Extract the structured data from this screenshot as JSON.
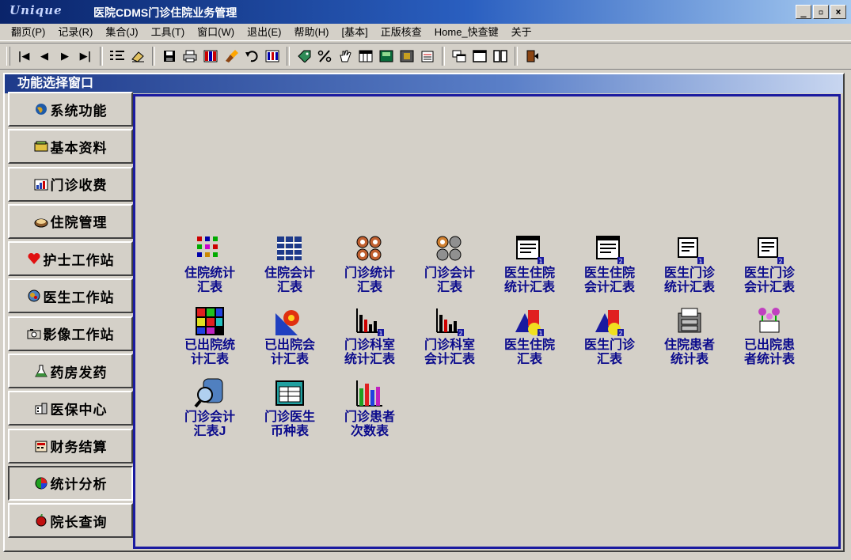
{
  "window": {
    "logo": "Unique",
    "title": "医院CDMS门诊住院业务管理",
    "min_label": "_",
    "max_label": "▫",
    "close_label": "×"
  },
  "menu": [
    {
      "label": "翻页(P)"
    },
    {
      "label": "记录(R)"
    },
    {
      "label": "集合(J)"
    },
    {
      "label": "工具(T)"
    },
    {
      "label": "窗口(W)"
    },
    {
      "label": "退出(E)"
    },
    {
      "label": "帮助(H)"
    },
    {
      "label": "[基本]"
    },
    {
      "label": "正版核查"
    },
    {
      "label": "Home_快查键"
    },
    {
      "label": "关于"
    }
  ],
  "toolbar": {
    "first": "|◀",
    "prev": "◀",
    "next": "▶",
    "last": "▶|"
  },
  "func_window": {
    "title": "功能选择窗口"
  },
  "sidebar": [
    {
      "label": "系统功能",
      "icon": "globe-icon"
    },
    {
      "label": "基本资料",
      "icon": "folder-icon"
    },
    {
      "label": "门诊收费",
      "icon": "chart-icon"
    },
    {
      "label": "住院管理",
      "icon": "bed-icon"
    },
    {
      "label": "护士工作站",
      "icon": "heart-icon"
    },
    {
      "label": "医生工作站",
      "icon": "doctor-icon"
    },
    {
      "label": "影像工作站",
      "icon": "camera-icon"
    },
    {
      "label": "药房发药",
      "icon": "flask-icon"
    },
    {
      "label": "医保中心",
      "icon": "building-icon"
    },
    {
      "label": "财务结算",
      "icon": "calculator-icon"
    },
    {
      "label": "统计分析",
      "icon": "pie-chart-icon"
    },
    {
      "label": "院长查询",
      "icon": "apple-icon"
    }
  ],
  "reports": [
    {
      "line1": "住院统计",
      "line2": "汇表",
      "icon": "dots-grid-icon"
    },
    {
      "line1": "住院会计",
      "line2": "汇表",
      "icon": "blue-grid-icon"
    },
    {
      "line1": "门诊统计",
      "line2": "汇表",
      "icon": "gears-icon"
    },
    {
      "line1": "门诊会计",
      "line2": "汇表",
      "icon": "gears-grey-icon"
    },
    {
      "line1": "医生住院",
      "line2": "统计汇表",
      "icon": "document-1-icon"
    },
    {
      "line1": "医生住院",
      "line2": "会计汇表",
      "icon": "document-2-icon"
    },
    {
      "line1": "医生门诊",
      "line2": "统计汇表",
      "icon": "printer-1-icon"
    },
    {
      "line1": "医生门诊",
      "line2": "会计汇表",
      "icon": "printer-2-icon"
    },
    {
      "line1": "已出院统",
      "line2": "计汇表",
      "icon": "colorful-blocks-icon"
    },
    {
      "line1": "已出院会",
      "line2": "计汇表",
      "icon": "gear-rays-icon"
    },
    {
      "line1": "门诊科室",
      "line2": "统计汇表",
      "icon": "bar-chart-1-icon"
    },
    {
      "line1": "门诊科室",
      "line2": "会计汇表",
      "icon": "bar-chart-2-icon"
    },
    {
      "line1": "医生住院",
      "line2": "汇表",
      "icon": "shapes-1-icon"
    },
    {
      "line1": "医生门诊",
      "line2": "汇表",
      "icon": "shapes-2-icon"
    },
    {
      "line1": "住院患者",
      "line2": "统计表",
      "icon": "cabinet-icon"
    },
    {
      "line1": "已出院患",
      "line2": "者统计表",
      "icon": "flowers-icon"
    },
    {
      "line1": "门诊会计",
      "line2": "汇表J",
      "icon": "magnifier-icon"
    },
    {
      "line1": "门诊医生",
      "line2": "币种表",
      "icon": "window-icon"
    },
    {
      "line1": "门诊患者",
      "line2": "次数表",
      "icon": "color-bars-icon"
    }
  ]
}
